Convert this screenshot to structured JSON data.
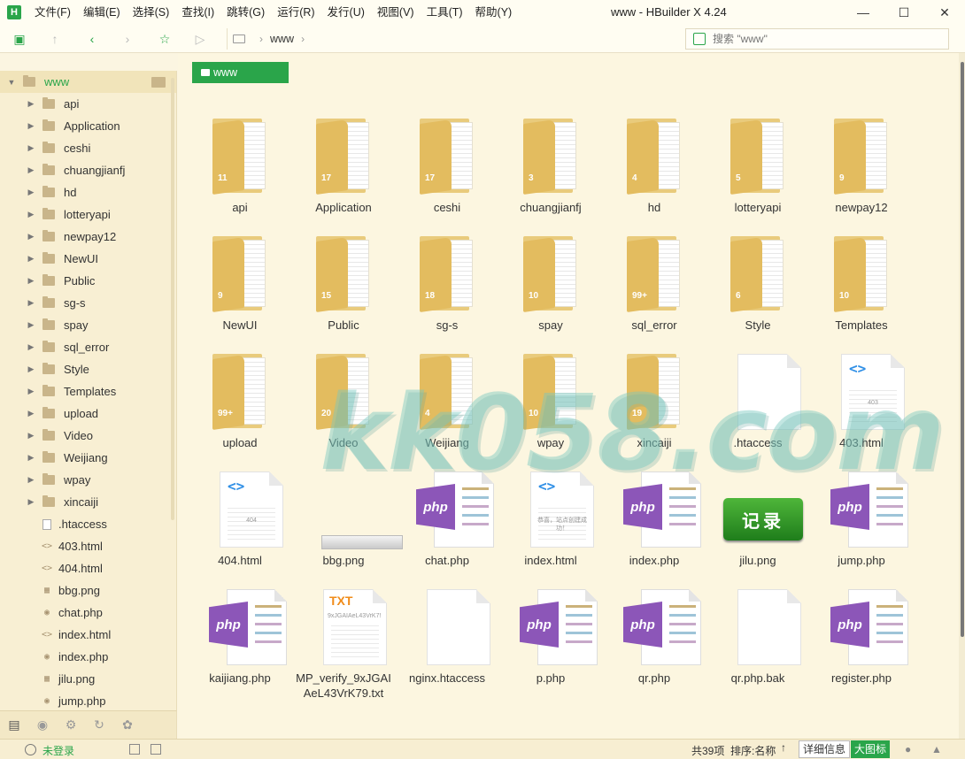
{
  "app": {
    "logo": "H",
    "window_title": "www - HBuilder X 4.24",
    "menu": [
      "文件(F)",
      "编辑(E)",
      "选择(S)",
      "查找(I)",
      "跳转(G)",
      "运行(R)",
      "发行(U)",
      "视图(V)",
      "工具(T)",
      "帮助(Y)"
    ]
  },
  "toolbar": {
    "breadcrumb": "www",
    "search_placeholder": "搜索 \"www\""
  },
  "sidebar": {
    "root": "www",
    "folders": [
      "api",
      "Application",
      "ceshi",
      "chuangjianfj",
      "hd",
      "lotteryapi",
      "newpay12",
      "NewUI",
      "Public",
      "sg-s",
      "spay",
      "sql_error",
      "Style",
      "Templates",
      "upload",
      "Video",
      "Weijiang",
      "wpay",
      "xincaiji"
    ],
    "files": [
      {
        "name": ".htaccess",
        "icon": "file-icon"
      },
      {
        "name": "403.html",
        "icon": "html-icon"
      },
      {
        "name": "404.html",
        "icon": "html-icon"
      },
      {
        "name": "bbg.png",
        "icon": "image-icon"
      },
      {
        "name": "chat.php",
        "icon": "php-icon"
      },
      {
        "name": "index.html",
        "icon": "html-icon"
      },
      {
        "name": "index.php",
        "icon": "php-icon"
      },
      {
        "name": "jilu.png",
        "icon": "image-icon"
      },
      {
        "name": "jump.php",
        "icon": "php-icon"
      }
    ]
  },
  "main": {
    "crumb_button": "www",
    "items": [
      {
        "name": "api",
        "kind": "folder",
        "count": "11"
      },
      {
        "name": "Application",
        "kind": "folder",
        "count": "17"
      },
      {
        "name": "ceshi",
        "kind": "folder",
        "count": "17"
      },
      {
        "name": "chuangjianfj",
        "kind": "folder",
        "count": "3"
      },
      {
        "name": "hd",
        "kind": "folder",
        "count": "4"
      },
      {
        "name": "lotteryapi",
        "kind": "folder",
        "count": "5"
      },
      {
        "name": "newpay12",
        "kind": "folder",
        "count": "9"
      },
      {
        "name": "NewUI",
        "kind": "folder",
        "count": "9"
      },
      {
        "name": "Public",
        "kind": "folder",
        "count": "15"
      },
      {
        "name": "sg-s",
        "kind": "folder",
        "count": "18"
      },
      {
        "name": "spay",
        "kind": "folder",
        "count": "10"
      },
      {
        "name": "sql_error",
        "kind": "folder",
        "count": "99+"
      },
      {
        "name": "Style",
        "kind": "folder",
        "count": "6"
      },
      {
        "name": "Templates",
        "kind": "folder",
        "count": "10"
      },
      {
        "name": "upload",
        "kind": "folder",
        "count": "99+"
      },
      {
        "name": "Video",
        "kind": "folder",
        "count": "20"
      },
      {
        "name": "Weijiang",
        "kind": "folder",
        "count": "4"
      },
      {
        "name": "wpay",
        "kind": "folder",
        "count": "10"
      },
      {
        "name": "xincaiji",
        "kind": "folder",
        "count": "19"
      },
      {
        "name": ".htaccess",
        "kind": "blank"
      },
      {
        "name": "403.html",
        "kind": "html",
        "preview": "403"
      },
      {
        "name": "404.html",
        "kind": "html",
        "preview": "404"
      },
      {
        "name": "bbg.png",
        "kind": "bbg"
      },
      {
        "name": "chat.php",
        "kind": "php"
      },
      {
        "name": "index.html",
        "kind": "html",
        "preview": "恭喜，站点创建成功！"
      },
      {
        "name": "index.php",
        "kind": "php"
      },
      {
        "name": "jilu.png",
        "kind": "jilu",
        "preview": "记录"
      },
      {
        "name": "jump.php",
        "kind": "php"
      },
      {
        "name": "kaijiang.php",
        "kind": "php"
      },
      {
        "name": "MP_verify_9xJGAIAeL43VrK79.txt",
        "kind": "txt",
        "preview": "9xJGAIAeL43VrK7!"
      },
      {
        "name": "nginx.htaccess",
        "kind": "blank"
      },
      {
        "name": "p.php",
        "kind": "php"
      },
      {
        "name": "qr.php",
        "kind": "php"
      },
      {
        "name": "qr.php.bak",
        "kind": "blank"
      },
      {
        "name": "register.php",
        "kind": "php"
      }
    ],
    "watermark": "kk058.com"
  },
  "status": {
    "login": "未登录",
    "count": "共39项",
    "sort": "排序:名称",
    "view_detail": "详细信息",
    "view_large": "大图标"
  },
  "colors": {
    "accent": "#2aa54a",
    "php": "#8c56b8",
    "folder": "#e3bc5f"
  }
}
